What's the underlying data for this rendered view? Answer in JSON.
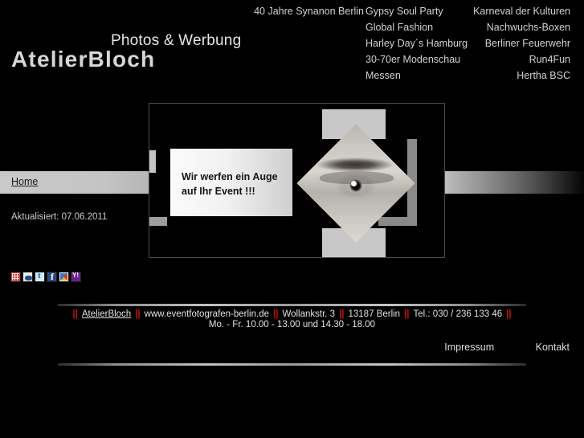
{
  "header": {
    "logo_tagline": "Photos & Werbung",
    "logo_name": "AtelierBloch",
    "nav_col_1": [
      {
        "label": "40 Jahre Synanon Berlin"
      }
    ],
    "nav_col_2": [
      {
        "label": "Gypsy Soul Party"
      },
      {
        "label": "Global Fashion"
      },
      {
        "label": "Harley Day´s Hamburg"
      },
      {
        "label": "30-70er Modenschau"
      },
      {
        "label": "Messen"
      }
    ],
    "nav_col_3": [
      {
        "label": "Karneval der Kulturen"
      },
      {
        "label": "Nachwuchs-Boxen"
      },
      {
        "label": "Berliner Feuerwehr"
      },
      {
        "label": "Run4Fun"
      },
      {
        "label": "Hertha BSC"
      }
    ]
  },
  "stage": {
    "slogan_line_1": "Wir werfen ein Auge",
    "slogan_line_2": "auf Ihr Event !!!",
    "eye_image_alt": "eye-diamond"
  },
  "sidebar": {
    "home_label": "Home",
    "updated_text": "Aktualisiert:  07.06.2011"
  },
  "social": [
    {
      "name": "delicious-icon",
      "label": "Delicious"
    },
    {
      "name": "mister-wong-icon",
      "label": "Mister Wong"
    },
    {
      "name": "twitter-icon",
      "label": "Twitter"
    },
    {
      "name": "facebook-icon",
      "label": "Facebook"
    },
    {
      "name": "google-icon",
      "label": "Google"
    },
    {
      "name": "yahoo-icon",
      "label": "Yahoo"
    }
  ],
  "footer": {
    "company": "AtelierBloch",
    "website": "www.eventfotografen-berlin.de",
    "street": "Wollankstr. 3",
    "city": "13187 Berlin",
    "phone": "Tel.: 030 / 236 133 46",
    "hours": "Mo. - Fr.  10.00 - 13.00 und 14.30 - 18.00",
    "separator": "||",
    "link_impressum": "Impressum",
    "link_kontakt": "Kontakt"
  },
  "colors": {
    "background": "#000000",
    "text": "#d2d2d2",
    "separator_red": "#cc1111",
    "bar_light": "#c9c9c9"
  }
}
